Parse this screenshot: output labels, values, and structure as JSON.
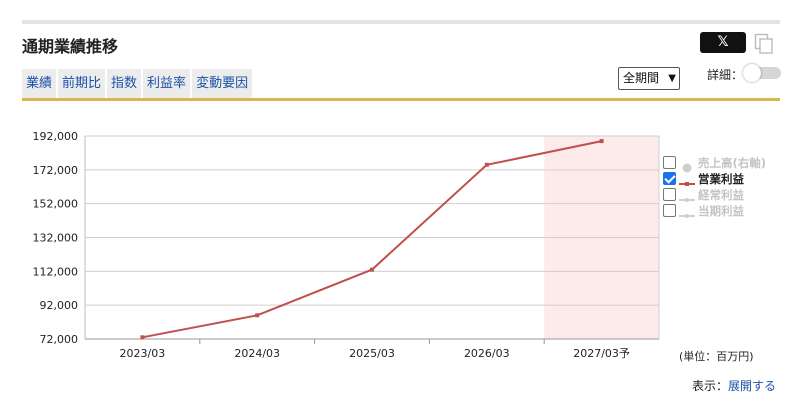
{
  "title": "通期業績推移",
  "share": {
    "x_label": "𝕏"
  },
  "tabs": [
    {
      "label": "業績",
      "active": true
    },
    {
      "label": "前期比",
      "active": false
    },
    {
      "label": "指数",
      "active": false
    },
    {
      "label": "利益率",
      "active": false
    },
    {
      "label": "変動要因",
      "active": false
    }
  ],
  "period_select": {
    "value": "全期間"
  },
  "detail_toggle": {
    "label": "詳細：",
    "on": false
  },
  "legend": [
    {
      "label": "売上高(右軸)",
      "checked": false,
      "marker": "dot"
    },
    {
      "label": "営業利益",
      "checked": true,
      "marker": "line-square"
    },
    {
      "label": "経常利益",
      "checked": false,
      "marker": "line-dot"
    },
    {
      "label": "当期利益",
      "checked": false,
      "marker": "line-dot"
    }
  ],
  "unit_label": "(単位：百万円)",
  "display": {
    "label": "表示：",
    "link": "展開する"
  },
  "colors": {
    "accent": "#d9b64e",
    "series": "#c0504d",
    "forecast_band": "#fdeaea",
    "link": "#1a52a8"
  },
  "chart_data": {
    "type": "line",
    "categories": [
      "2023/03",
      "2024/03",
      "2025/03",
      "2026/03",
      "2027/03予"
    ],
    "series": [
      {
        "name": "営業利益",
        "values": [
          73000,
          86000,
          113000,
          175000,
          189000
        ]
      }
    ],
    "y_ticks": [
      "72,000",
      "92,000",
      "112,000",
      "132,000",
      "152,000",
      "172,000",
      "192,000"
    ],
    "ylim": [
      72000,
      192000
    ],
    "forecast_category_index": 4,
    "grid": true,
    "legend_position": "right"
  }
}
